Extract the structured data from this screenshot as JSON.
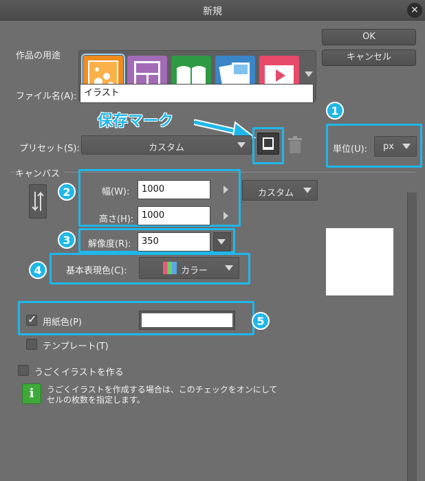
{
  "window": {
    "title": "新規"
  },
  "buttons": {
    "ok": "OK",
    "cancel": "キャンセル"
  },
  "usage": {
    "label": "作品の用途",
    "icons": [
      {
        "name": "illustration-usage-icon",
        "color": "#f08c1e"
      },
      {
        "name": "comic-usage-icon",
        "color": "#a36bb5"
      },
      {
        "name": "book-usage-icon",
        "color": "#2f9a44"
      },
      {
        "name": "web-comic-usage-icon",
        "color": "#3a86c8"
      },
      {
        "name": "animation-usage-icon",
        "color": "#e84a6a"
      }
    ]
  },
  "file": {
    "label": "ファイル名(A):",
    "value": "イラスト"
  },
  "annotation": {
    "save_mark": "保存マーク"
  },
  "preset": {
    "label": "プリセット(S):",
    "value": "カスタム"
  },
  "unit": {
    "label": "単位(U):",
    "value": "px"
  },
  "canvas": {
    "section_label": "キャンバス",
    "width_label": "幅(W):",
    "width_value": "1000",
    "height_label": "高さ(H):",
    "height_value": "1000",
    "size_preset": "カスタム",
    "resolution_label": "解像度(R):",
    "resolution_value": "350",
    "color_mode_label": "基本表現色(C):",
    "color_mode_value": "カラー",
    "paper_color_label": "用紙色(P)",
    "paper_color_checked": true,
    "paper_color": "#ffffff",
    "template_label": "テンプレート(T)"
  },
  "animation": {
    "checkbox_label": "うごくイラストを作る",
    "info_line1": "うごくイラストを作成する場合は、このチェックをオンにして",
    "info_line2": "セルの枚数を指定します。"
  },
  "badges": [
    "1",
    "2",
    "3",
    "4",
    "5"
  ],
  "colors": {
    "highlight": "#1fb7ea",
    "dialog_bg": "#6e6e6e"
  }
}
